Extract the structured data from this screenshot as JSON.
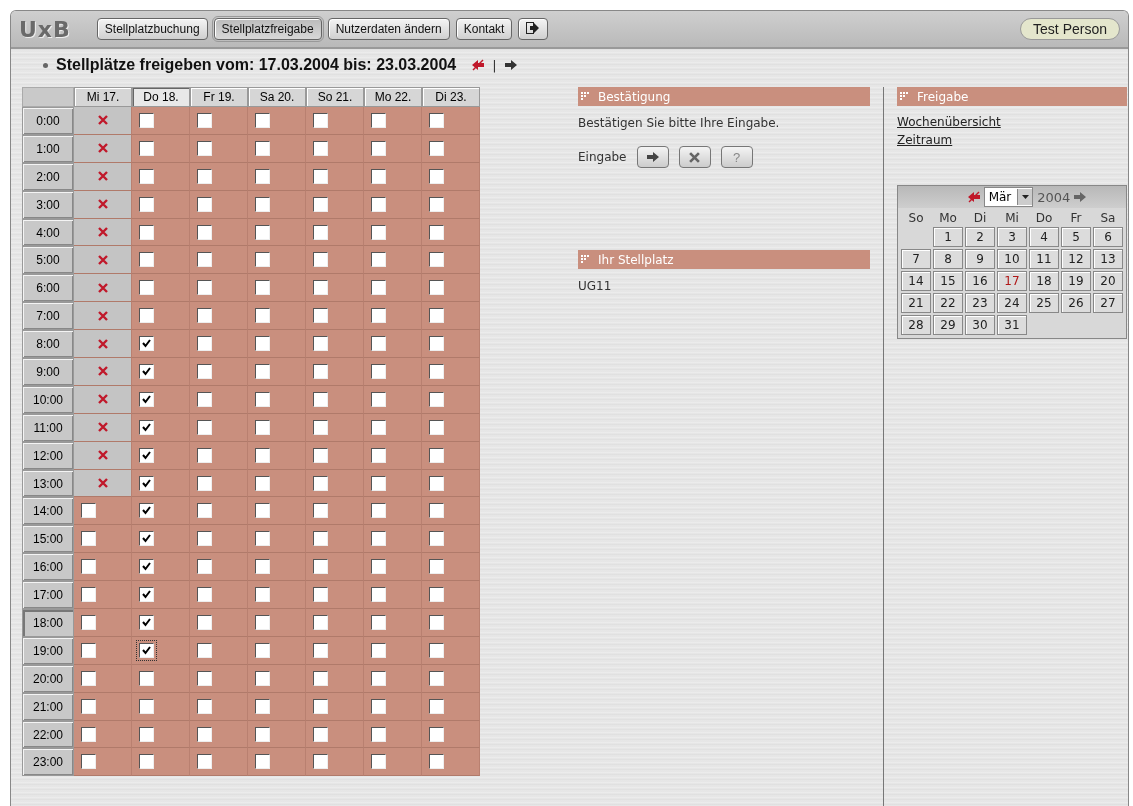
{
  "topbar": {
    "logo": "UxB",
    "nav": [
      {
        "label": "Stellplatzbuchung",
        "selected": false
      },
      {
        "label": "Stellplatzfreigabe",
        "selected": true
      },
      {
        "label": "Nutzerdaten ändern",
        "selected": false
      },
      {
        "label": "Kontakt",
        "selected": false
      }
    ],
    "user": "Test Person"
  },
  "heading": {
    "title": "Stellplätze freigeben vom: 17.03.2004 bis: 23.03.2004",
    "separator": "|"
  },
  "grid": {
    "days": [
      {
        "label": "Mi 17.",
        "selected": false
      },
      {
        "label": "Do 18.",
        "selected": true
      },
      {
        "label": "Fr 19.",
        "selected": false
      },
      {
        "label": "Sa 20.",
        "selected": false
      },
      {
        "label": "So 21.",
        "selected": false
      },
      {
        "label": "Mo 22.",
        "selected": false
      },
      {
        "label": "Di 23.",
        "selected": false
      }
    ],
    "rows": [
      {
        "time": "0:00",
        "selected": false,
        "cells": [
          {
            "kind": "blocked"
          },
          {
            "kind": "checkbox",
            "checked": false
          },
          {
            "kind": "checkbox",
            "checked": false
          },
          {
            "kind": "checkbox",
            "checked": false
          },
          {
            "kind": "checkbox",
            "checked": false
          },
          {
            "kind": "checkbox",
            "checked": false
          },
          {
            "kind": "checkbox",
            "checked": false
          }
        ]
      },
      {
        "time": "1:00",
        "selected": false,
        "cells": [
          {
            "kind": "blocked"
          },
          {
            "kind": "checkbox",
            "checked": false
          },
          {
            "kind": "checkbox",
            "checked": false
          },
          {
            "kind": "checkbox",
            "checked": false
          },
          {
            "kind": "checkbox",
            "checked": false
          },
          {
            "kind": "checkbox",
            "checked": false
          },
          {
            "kind": "checkbox",
            "checked": false
          }
        ]
      },
      {
        "time": "2:00",
        "selected": false,
        "cells": [
          {
            "kind": "blocked"
          },
          {
            "kind": "checkbox",
            "checked": false
          },
          {
            "kind": "checkbox",
            "checked": false
          },
          {
            "kind": "checkbox",
            "checked": false
          },
          {
            "kind": "checkbox",
            "checked": false
          },
          {
            "kind": "checkbox",
            "checked": false
          },
          {
            "kind": "checkbox",
            "checked": false
          }
        ]
      },
      {
        "time": "3:00",
        "selected": false,
        "cells": [
          {
            "kind": "blocked"
          },
          {
            "kind": "checkbox",
            "checked": false
          },
          {
            "kind": "checkbox",
            "checked": false
          },
          {
            "kind": "checkbox",
            "checked": false
          },
          {
            "kind": "checkbox",
            "checked": false
          },
          {
            "kind": "checkbox",
            "checked": false
          },
          {
            "kind": "checkbox",
            "checked": false
          }
        ]
      },
      {
        "time": "4:00",
        "selected": false,
        "cells": [
          {
            "kind": "blocked"
          },
          {
            "kind": "checkbox",
            "checked": false
          },
          {
            "kind": "checkbox",
            "checked": false
          },
          {
            "kind": "checkbox",
            "checked": false
          },
          {
            "kind": "checkbox",
            "checked": false
          },
          {
            "kind": "checkbox",
            "checked": false
          },
          {
            "kind": "checkbox",
            "checked": false
          }
        ]
      },
      {
        "time": "5:00",
        "selected": false,
        "cells": [
          {
            "kind": "blocked"
          },
          {
            "kind": "checkbox",
            "checked": false
          },
          {
            "kind": "checkbox",
            "checked": false
          },
          {
            "kind": "checkbox",
            "checked": false
          },
          {
            "kind": "checkbox",
            "checked": false
          },
          {
            "kind": "checkbox",
            "checked": false
          },
          {
            "kind": "checkbox",
            "checked": false
          }
        ]
      },
      {
        "time": "6:00",
        "selected": false,
        "cells": [
          {
            "kind": "blocked"
          },
          {
            "kind": "checkbox",
            "checked": false
          },
          {
            "kind": "checkbox",
            "checked": false
          },
          {
            "kind": "checkbox",
            "checked": false
          },
          {
            "kind": "checkbox",
            "checked": false
          },
          {
            "kind": "checkbox",
            "checked": false
          },
          {
            "kind": "checkbox",
            "checked": false
          }
        ]
      },
      {
        "time": "7:00",
        "selected": false,
        "cells": [
          {
            "kind": "blocked"
          },
          {
            "kind": "checkbox",
            "checked": false
          },
          {
            "kind": "checkbox",
            "checked": false
          },
          {
            "kind": "checkbox",
            "checked": false
          },
          {
            "kind": "checkbox",
            "checked": false
          },
          {
            "kind": "checkbox",
            "checked": false
          },
          {
            "kind": "checkbox",
            "checked": false
          }
        ]
      },
      {
        "time": "8:00",
        "selected": false,
        "cells": [
          {
            "kind": "blocked"
          },
          {
            "kind": "checkbox",
            "checked": true
          },
          {
            "kind": "checkbox",
            "checked": false
          },
          {
            "kind": "checkbox",
            "checked": false
          },
          {
            "kind": "checkbox",
            "checked": false
          },
          {
            "kind": "checkbox",
            "checked": false
          },
          {
            "kind": "checkbox",
            "checked": false
          }
        ]
      },
      {
        "time": "9:00",
        "selected": false,
        "cells": [
          {
            "kind": "blocked"
          },
          {
            "kind": "checkbox",
            "checked": true
          },
          {
            "kind": "checkbox",
            "checked": false
          },
          {
            "kind": "checkbox",
            "checked": false
          },
          {
            "kind": "checkbox",
            "checked": false
          },
          {
            "kind": "checkbox",
            "checked": false
          },
          {
            "kind": "checkbox",
            "checked": false
          }
        ]
      },
      {
        "time": "10:00",
        "selected": false,
        "cells": [
          {
            "kind": "blocked"
          },
          {
            "kind": "checkbox",
            "checked": true
          },
          {
            "kind": "checkbox",
            "checked": false
          },
          {
            "kind": "checkbox",
            "checked": false
          },
          {
            "kind": "checkbox",
            "checked": false
          },
          {
            "kind": "checkbox",
            "checked": false
          },
          {
            "kind": "checkbox",
            "checked": false
          }
        ]
      },
      {
        "time": "11:00",
        "selected": false,
        "cells": [
          {
            "kind": "blocked"
          },
          {
            "kind": "checkbox",
            "checked": true
          },
          {
            "kind": "checkbox",
            "checked": false
          },
          {
            "kind": "checkbox",
            "checked": false
          },
          {
            "kind": "checkbox",
            "checked": false
          },
          {
            "kind": "checkbox",
            "checked": false
          },
          {
            "kind": "checkbox",
            "checked": false
          }
        ]
      },
      {
        "time": "12:00",
        "selected": false,
        "cells": [
          {
            "kind": "blocked"
          },
          {
            "kind": "checkbox",
            "checked": true
          },
          {
            "kind": "checkbox",
            "checked": false
          },
          {
            "kind": "checkbox",
            "checked": false
          },
          {
            "kind": "checkbox",
            "checked": false
          },
          {
            "kind": "checkbox",
            "checked": false
          },
          {
            "kind": "checkbox",
            "checked": false
          }
        ]
      },
      {
        "time": "13:00",
        "selected": false,
        "cells": [
          {
            "kind": "blocked"
          },
          {
            "kind": "checkbox",
            "checked": true
          },
          {
            "kind": "checkbox",
            "checked": false
          },
          {
            "kind": "checkbox",
            "checked": false
          },
          {
            "kind": "checkbox",
            "checked": false
          },
          {
            "kind": "checkbox",
            "checked": false
          },
          {
            "kind": "checkbox",
            "checked": false
          }
        ]
      },
      {
        "time": "14:00",
        "selected": false,
        "cells": [
          {
            "kind": "checkbox",
            "checked": false
          },
          {
            "kind": "checkbox",
            "checked": true
          },
          {
            "kind": "checkbox",
            "checked": false
          },
          {
            "kind": "checkbox",
            "checked": false
          },
          {
            "kind": "checkbox",
            "checked": false
          },
          {
            "kind": "checkbox",
            "checked": false
          },
          {
            "kind": "checkbox",
            "checked": false
          }
        ]
      },
      {
        "time": "15:00",
        "selected": false,
        "cells": [
          {
            "kind": "checkbox",
            "checked": false
          },
          {
            "kind": "checkbox",
            "checked": true
          },
          {
            "kind": "checkbox",
            "checked": false
          },
          {
            "kind": "checkbox",
            "checked": false
          },
          {
            "kind": "checkbox",
            "checked": false
          },
          {
            "kind": "checkbox",
            "checked": false
          },
          {
            "kind": "checkbox",
            "checked": false
          }
        ]
      },
      {
        "time": "16:00",
        "selected": false,
        "cells": [
          {
            "kind": "checkbox",
            "checked": false
          },
          {
            "kind": "checkbox",
            "checked": true
          },
          {
            "kind": "checkbox",
            "checked": false
          },
          {
            "kind": "checkbox",
            "checked": false
          },
          {
            "kind": "checkbox",
            "checked": false
          },
          {
            "kind": "checkbox",
            "checked": false
          },
          {
            "kind": "checkbox",
            "checked": false
          }
        ]
      },
      {
        "time": "17:00",
        "selected": false,
        "cells": [
          {
            "kind": "checkbox",
            "checked": false
          },
          {
            "kind": "checkbox",
            "checked": true
          },
          {
            "kind": "checkbox",
            "checked": false
          },
          {
            "kind": "checkbox",
            "checked": false
          },
          {
            "kind": "checkbox",
            "checked": false
          },
          {
            "kind": "checkbox",
            "checked": false
          },
          {
            "kind": "checkbox",
            "checked": false
          }
        ]
      },
      {
        "time": "18:00",
        "selected": true,
        "cells": [
          {
            "kind": "checkbox",
            "checked": false
          },
          {
            "kind": "checkbox",
            "checked": true
          },
          {
            "kind": "checkbox",
            "checked": false
          },
          {
            "kind": "checkbox",
            "checked": false
          },
          {
            "kind": "checkbox",
            "checked": false
          },
          {
            "kind": "checkbox",
            "checked": false
          },
          {
            "kind": "checkbox",
            "checked": false
          }
        ]
      },
      {
        "time": "19:00",
        "selected": false,
        "cells": [
          {
            "kind": "checkbox",
            "checked": false
          },
          {
            "kind": "checkbox",
            "checked": true,
            "focused": true
          },
          {
            "kind": "checkbox",
            "checked": false
          },
          {
            "kind": "checkbox",
            "checked": false
          },
          {
            "kind": "checkbox",
            "checked": false
          },
          {
            "kind": "checkbox",
            "checked": false
          },
          {
            "kind": "checkbox",
            "checked": false
          }
        ]
      },
      {
        "time": "20:00",
        "selected": false,
        "cells": [
          {
            "kind": "checkbox",
            "checked": false
          },
          {
            "kind": "checkbox",
            "checked": false
          },
          {
            "kind": "checkbox",
            "checked": false
          },
          {
            "kind": "checkbox",
            "checked": false
          },
          {
            "kind": "checkbox",
            "checked": false
          },
          {
            "kind": "checkbox",
            "checked": false
          },
          {
            "kind": "checkbox",
            "checked": false
          }
        ]
      },
      {
        "time": "21:00",
        "selected": false,
        "cells": [
          {
            "kind": "checkbox",
            "checked": false
          },
          {
            "kind": "checkbox",
            "checked": false
          },
          {
            "kind": "checkbox",
            "checked": false
          },
          {
            "kind": "checkbox",
            "checked": false
          },
          {
            "kind": "checkbox",
            "checked": false
          },
          {
            "kind": "checkbox",
            "checked": false
          },
          {
            "kind": "checkbox",
            "checked": false
          }
        ]
      },
      {
        "time": "22:00",
        "selected": false,
        "cells": [
          {
            "kind": "checkbox",
            "checked": false
          },
          {
            "kind": "checkbox",
            "checked": false
          },
          {
            "kind": "checkbox",
            "checked": false
          },
          {
            "kind": "checkbox",
            "checked": false
          },
          {
            "kind": "checkbox",
            "checked": false
          },
          {
            "kind": "checkbox",
            "checked": false
          },
          {
            "kind": "checkbox",
            "checked": false
          }
        ]
      },
      {
        "time": "23:00",
        "selected": false,
        "cells": [
          {
            "kind": "checkbox",
            "checked": false
          },
          {
            "kind": "checkbox",
            "checked": false
          },
          {
            "kind": "checkbox",
            "checked": false
          },
          {
            "kind": "checkbox",
            "checked": false
          },
          {
            "kind": "checkbox",
            "checked": false
          },
          {
            "kind": "checkbox",
            "checked": false
          },
          {
            "kind": "checkbox",
            "checked": false
          }
        ]
      }
    ]
  },
  "confirmation": {
    "title": "Bestätigung",
    "message": "Bestätigen Sie bitte Ihre Eingabe.",
    "input_label": "Eingabe",
    "help_button": "?"
  },
  "parking_space": {
    "title": "Ihr Stellplatz",
    "value": "UG11"
  },
  "release": {
    "title": "Freigabe",
    "links": [
      "Wochenübersicht",
      "Zeitraum"
    ],
    "calendar": {
      "month": "Mär",
      "year": "2004",
      "weekdays": [
        "So",
        "Mo",
        "Di",
        "Mi",
        "Do",
        "Fr",
        "Sa"
      ],
      "weeks": [
        {
          "days": [
            {
              "label": "1",
              "today": false
            },
            {
              "label": "2",
              "today": false
            },
            {
              "label": "3",
              "today": false
            },
            {
              "label": "4",
              "today": false
            },
            {
              "label": "5",
              "today": false
            },
            {
              "label": "6",
              "today": false
            }
          ]
        },
        {
          "days": [
            {
              "label": "7",
              "today": false
            },
            {
              "label": "8",
              "today": false
            },
            {
              "label": "9",
              "today": false
            },
            {
              "label": "10",
              "today": false
            },
            {
              "label": "11",
              "today": false
            },
            {
              "label": "12",
              "today": false
            },
            {
              "label": "13",
              "today": false
            }
          ]
        },
        {
          "days": [
            {
              "label": "14",
              "today": false
            },
            {
              "label": "15",
              "today": false
            },
            {
              "label": "16",
              "today": false
            },
            {
              "label": "17",
              "today": true
            },
            {
              "label": "18",
              "today": false
            },
            {
              "label": "19",
              "today": false
            },
            {
              "label": "20",
              "today": false
            }
          ]
        },
        {
          "days": [
            {
              "label": "21",
              "today": false
            },
            {
              "label": "22",
              "today": false
            },
            {
              "label": "23",
              "today": false
            },
            {
              "label": "24",
              "today": false
            },
            {
              "label": "25",
              "today": false
            },
            {
              "label": "26",
              "today": false
            },
            {
              "label": "27",
              "today": false
            }
          ]
        },
        {
          "days": [
            {
              "label": "28",
              "today": false
            },
            {
              "label": "29",
              "today": false
            },
            {
              "label": "30",
              "today": false
            },
            {
              "label": "31",
              "today": false
            }
          ]
        }
      ]
    }
  }
}
